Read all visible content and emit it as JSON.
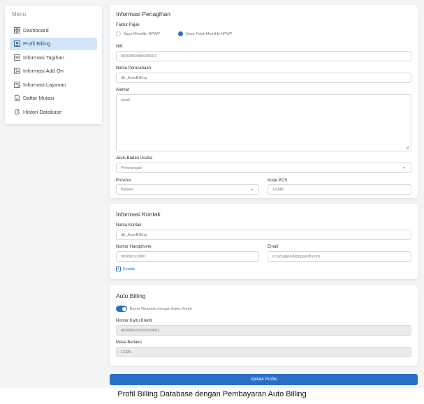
{
  "sidebar": {
    "menu_title": "Menu",
    "items": [
      {
        "label": "Dashboard",
        "icon": "dashboard-icon",
        "active": false
      },
      {
        "label": "Profil Billing",
        "icon": "profile-icon",
        "active": true
      },
      {
        "label": "Informasi Tagihan",
        "icon": "invoice-icon",
        "active": false
      },
      {
        "label": "Informasi Add On",
        "icon": "addon-icon",
        "active": false
      },
      {
        "label": "Informasi Layanan",
        "icon": "service-icon",
        "active": false
      },
      {
        "label": "Daftar Mutasi",
        "icon": "mutation-icon",
        "active": false
      },
      {
        "label": "Histori Database",
        "icon": "history-icon",
        "active": false
      }
    ]
  },
  "billing": {
    "title": "Informasi Penagihan",
    "tax_label": "Faktur Pajak",
    "tax_options": [
      {
        "label": "Saya Memiliki NPWP",
        "selected": false
      },
      {
        "label": "Saya Tidak Memiliki NPWP",
        "selected": true
      }
    ],
    "nik_label": "NIK",
    "nik_value": "0000000000000001",
    "company_label": "Nama Perusahaan",
    "company_value": "db_AutoBilling",
    "address_label": "Alamat",
    "address_value": "sisufi",
    "business_type_label": "Jenis Badan Usaha",
    "business_type_value": "Perorangan",
    "province_label": "Provinsi",
    "province_value": "Banten",
    "postal_label": "Kode POS",
    "postal_value": "12345"
  },
  "contact": {
    "title": "Informasi Kontak",
    "name_label": "Nama Kontak",
    "name_value": "db_AutoBilling",
    "phone_label": "Nomor Handphone",
    "phone_value": "08000222000",
    "email_label": "Email",
    "email_value": "ccs2support@cpssoft.com",
    "add_contact_label": "Kontak"
  },
  "auto_billing": {
    "title": "Auto Billing",
    "toggle_label": "Bayar Otomatis dengan Kartu Kredit",
    "toggle_on": true,
    "card_label": "Nomor Kartu Kredit",
    "card_value": "400000XXXXXX0002",
    "expiry_label": "Masa Berlaku",
    "expiry_value": "12/25"
  },
  "update_button": "Update Profile",
  "caption": "Profil Billing Database dengan Pembayaran Auto Billing",
  "colors": {
    "accent": "#2a6fc7",
    "active_bg": "#d3e6f8"
  }
}
